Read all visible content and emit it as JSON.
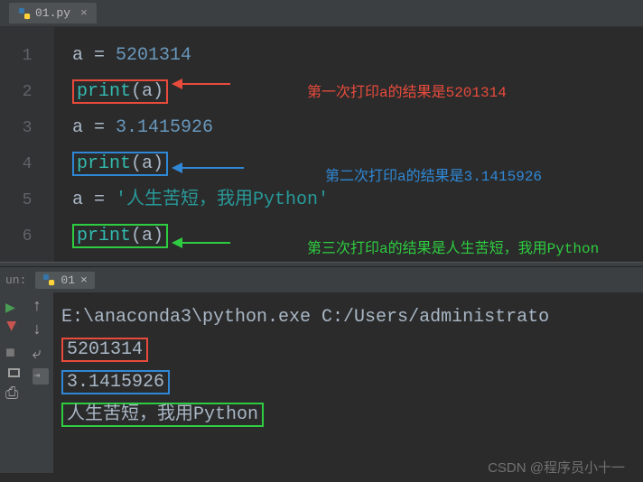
{
  "tab": {
    "filename": "01.py"
  },
  "code": {
    "lines": [
      "1",
      "2",
      "3",
      "4",
      "5",
      "6"
    ],
    "l1_var": "a",
    "l1_op": " = ",
    "l1_val": "5201314",
    "l2_func": "print",
    "l2_open": "(",
    "l2_arg": "a",
    "l2_close": ")",
    "l3_var": "a",
    "l3_op": " = ",
    "l3_val": "3.1415926",
    "l4_func": "print",
    "l4_open": "(",
    "l4_arg": "a",
    "l4_close": ")",
    "l5_var": "a",
    "l5_op": " = ",
    "l5_val": "'人生苦短，我用Python'",
    "l6_func": "print",
    "l6_open": "(",
    "l6_arg": "a",
    "l6_close": ")"
  },
  "annotations": {
    "a1": "第一次打印a的结果是5201314",
    "a2": "第二次打印a的结果是3.1415926",
    "a3": "第三次打印a的结果是人生苦短，我用Python"
  },
  "run": {
    "panel_label": "un:",
    "tab_name": "01",
    "command": "E:\\anaconda3\\python.exe C:/Users/administrato",
    "out1": "5201314",
    "out2": "3.1415926",
    "out3": "人生苦短，我用Python"
  },
  "watermark": "CSDN @程序员小十一"
}
